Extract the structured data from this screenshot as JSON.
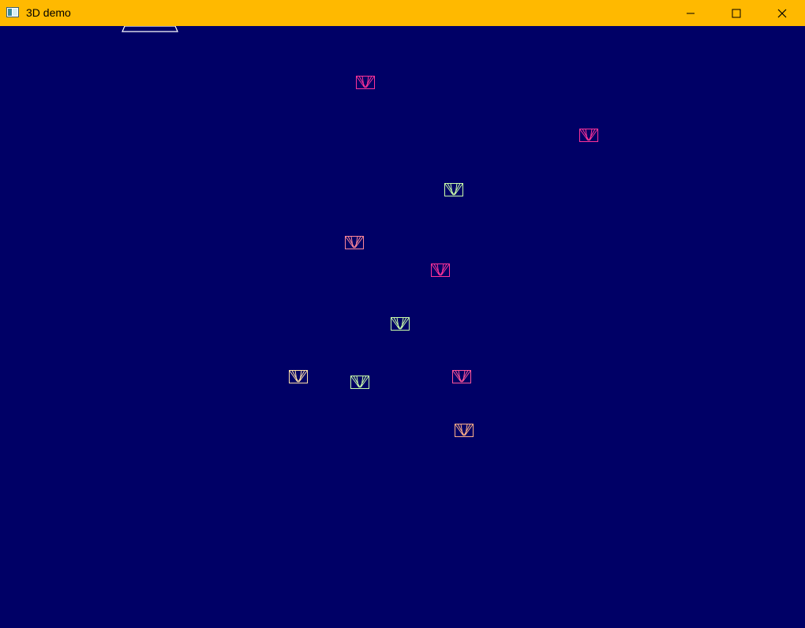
{
  "window": {
    "title": "3D demo",
    "titlebar_color": "#ffb900",
    "app_icon": "window-app-icon",
    "controls": [
      {
        "name": "minimize",
        "icon": "minimize-icon"
      },
      {
        "name": "maximize",
        "icon": "maximize-icon"
      },
      {
        "name": "close",
        "icon": "close-icon"
      }
    ]
  },
  "scene": {
    "background_color": "#000066",
    "player_ship": {
      "icon": "player-ship-icon",
      "color": "#ffffff"
    },
    "enemies": [
      {
        "name": "enemy-1",
        "color": "#ff3399"
      },
      {
        "name": "enemy-2",
        "color": "#ff3399"
      },
      {
        "name": "enemy-3",
        "color": "#ccffaa"
      },
      {
        "name": "enemy-4",
        "color": "#ff8899"
      },
      {
        "name": "enemy-5",
        "color": "#ff3399"
      },
      {
        "name": "enemy-6",
        "color": "#ccffaa"
      },
      {
        "name": "enemy-7",
        "color": "#ffe0a8"
      },
      {
        "name": "enemy-8",
        "color": "#ccffaa"
      },
      {
        "name": "enemy-9",
        "color": "#ff5599"
      },
      {
        "name": "enemy-10",
        "color": "#ffb088"
      }
    ]
  }
}
